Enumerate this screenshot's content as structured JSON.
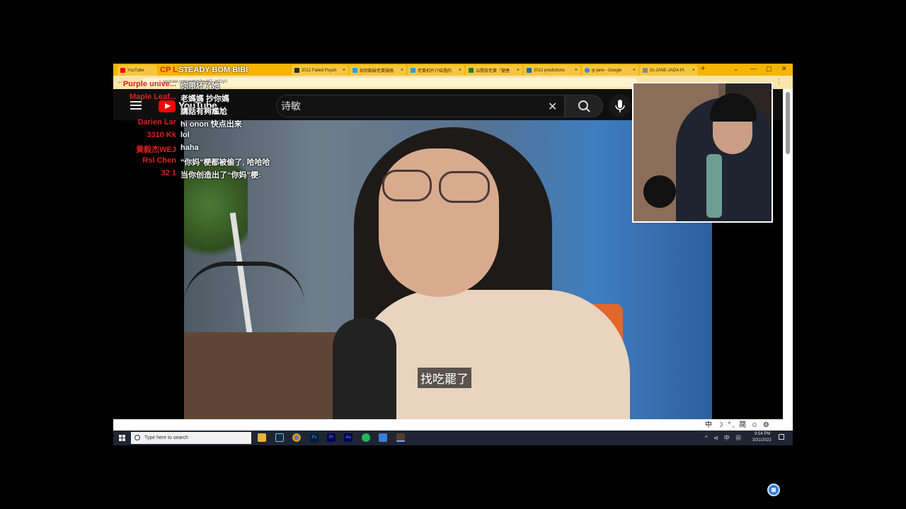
{
  "browser": {
    "tabs": [
      {
        "label": "YouTube",
        "color": "#ff0000"
      },
      {
        "label": "2012 Failed Psych",
        "color": "#2a2a2a"
      },
      {
        "label": "如何勸破老黃服務",
        "color": "#1da1f2"
      },
      {
        "label": "老黃拍片介紹過的",
        "color": "#1da1f2"
      },
      {
        "label": "以開放老黃「變唐",
        "color": "#1a7a3a"
      },
      {
        "label": "2012 predictions",
        "color": "#1a6ab0"
      },
      {
        "label": "gi jane - Google",
        "color": "#4285f4"
      },
      {
        "label": "GI-JANE-JADA-PI",
        "color": "#888888"
      }
    ],
    "url": "youtube.com/watch?v=M7_zt32y0"
  },
  "youtube": {
    "logo_text": "YouTube",
    "search_query": "诗敏"
  },
  "video": {
    "subtitle": "找吃罷了"
  },
  "stream_overlay": {
    "cp_label": "CP L",
    "alert_text": "STEADY BOM BIBI",
    "chat": [
      {
        "name": "Purple unive...",
        "message": "你带坏了她"
      },
      {
        "name": "Maple Leaf...",
        "message": "老媽媽 抄你媽"
      },
      {
        "name": "",
        "message": "講話有夠尷尬"
      },
      {
        "name": "Darien Lar",
        "message": "hi onon 快点出来"
      },
      {
        "name": "3310 Kk",
        "message": "lol"
      },
      {
        "name": "黄毅杰WEJ",
        "message": "haha"
      },
      {
        "name": "Rsl Chen",
        "message": "\"你妈\"梗都被偷了, 哈哈哈"
      },
      {
        "name": "32 1",
        "message": "当你创造出了“你妈”梗:"
      }
    ]
  },
  "ime": {
    "text": "中 ☽ °, 简 ☺ ⚙"
  },
  "taskbar": {
    "search_placeholder": "Type here to search",
    "tray": "^ ⊲ 中 ▦",
    "time": "9:54 PM",
    "date": "3/31/2022"
  },
  "colors": {
    "chrome_tab_bar": "#f5b400",
    "youtube_red": "#ff0000",
    "chat_name": "#e02020"
  }
}
